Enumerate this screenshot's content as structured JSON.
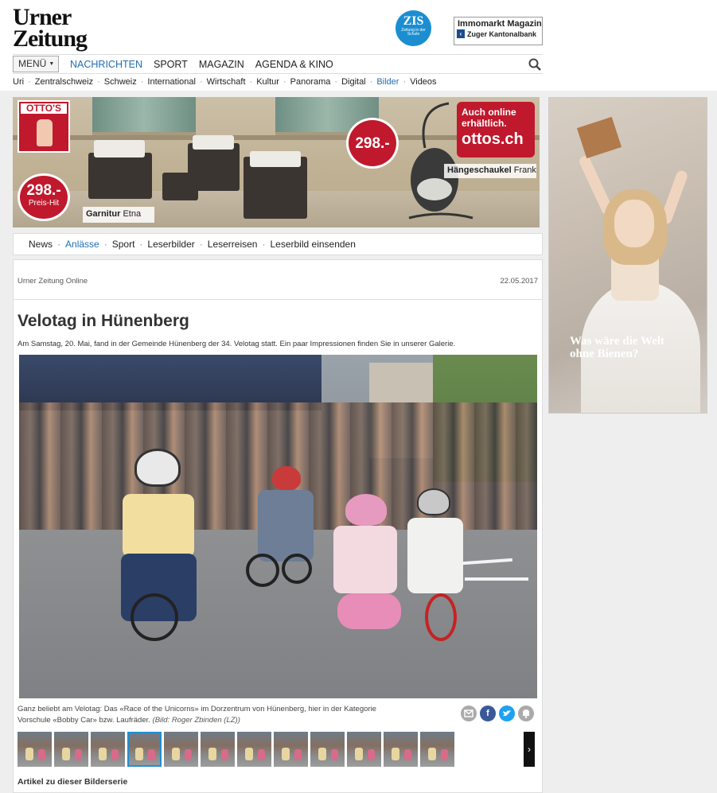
{
  "header": {
    "logo_line1": "Urner",
    "logo_line2": "Zeitung",
    "zis_big": "ZIS",
    "zis_small": "Zeitung in der Schule",
    "immo_title": "Immomarkt Magazin",
    "immo_sponsor": "Zuger Kantonalbank"
  },
  "mainnav": {
    "menu_label": "MENÜ",
    "items": [
      "NACHRICHTEN",
      "SPORT",
      "MAGAZIN",
      "AGENDA & KINO"
    ],
    "active_index": 0
  },
  "subnav": {
    "items": [
      "Uri",
      "Zentralschweiz",
      "Schweiz",
      "International",
      "Wirtschaft",
      "Kultur",
      "Panorama",
      "Digital",
      "Bilder",
      "Videos"
    ],
    "active": "Bilder"
  },
  "banner": {
    "brand": "OTTO'S",
    "price_hit": "298.-",
    "price_hit_label": "Preis-Hit",
    "price2": "298.-",
    "online_line1": "Auch online",
    "online_line2": "erhältlich.",
    "online_url": "ottos.ch",
    "product1_bold": "Garnitur",
    "product1_name": "Etna",
    "product2_bold": "Hängeschaukel",
    "product2_name": "Frank"
  },
  "side_ad": {
    "slogan_line1": "Was wäre die Welt",
    "slogan_line2": "ohne Bienen?"
  },
  "section_nav": {
    "items": [
      "News",
      "Anlässe",
      "Sport",
      "Leserbilder",
      "Leserreisen",
      "Leserbild einsenden"
    ],
    "active": "Anlässe"
  },
  "article": {
    "source": "Urner Zeitung Online",
    "date": "22.05.2017",
    "title": "Velotag in Hünenberg",
    "lead": "Am Samstag, 20. Mai, fand in der Gemeinde Hünenberg der 34. Velotag statt. Ein paar Impressionen finden Sie in unserer Galerie.",
    "caption_line1": "Ganz beliebt am Velotag: Das «Race of the Unicorns» im Dorzentrum von Hünenberg, hier in der Kategorie",
    "caption_line2": "Vorschule «Bobby Car» bzw. Laufräder.",
    "caption_credit": "(Bild: Roger Zbinden (LZ))",
    "thumbnail_count": 12,
    "selected_thumbnail": 4,
    "next_label": "›",
    "related_heading": "Artikel zu dieser Bilderserie"
  },
  "share": {
    "email_icon": "email-icon",
    "facebook_label": "f",
    "twitter_icon": "twitter-icon",
    "more_icon": "bell-icon"
  },
  "colors": {
    "link_blue": "#1f6eb5",
    "otto_red": "#c0182c",
    "facebook": "#3b5998",
    "twitter": "#1da1f2",
    "grey_button": "#aaaaaa"
  }
}
